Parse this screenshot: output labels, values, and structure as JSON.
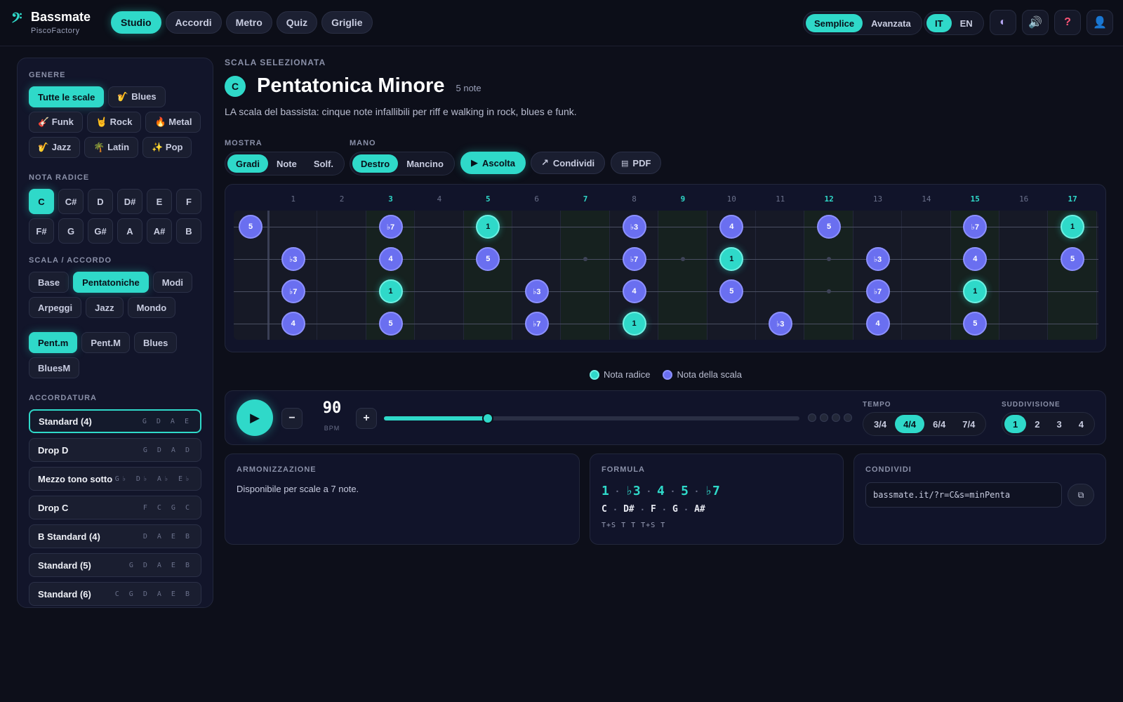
{
  "app": {
    "logo_mark": "𝄢",
    "title": "Bassmate",
    "subtitle": "PiscoFactory"
  },
  "nav": [
    "Studio",
    "Accordi",
    "Metro",
    "Quiz",
    "Griglie"
  ],
  "nav_active": 0,
  "mode": {
    "options": [
      "Semplice",
      "Avanzata"
    ],
    "active": 0
  },
  "lang": {
    "options": [
      "IT",
      "EN"
    ],
    "active": 0
  },
  "header_icons": [
    {
      "name": "theme-icon",
      "glyph": "◐",
      "color": "#b3a5f0"
    },
    {
      "name": "sound-icon",
      "glyph": "🔊",
      "color": "#d6dbff"
    },
    {
      "name": "help-icon",
      "glyph": "?",
      "color": "#ff5577"
    },
    {
      "name": "profile-icon",
      "glyph": "👤",
      "color": "#c8cce0"
    }
  ],
  "sidebar": {
    "genre_label": "GENERE",
    "genres": [
      {
        "label": "Tutte le scale",
        "active": true
      },
      {
        "label": "🎷 Blues"
      },
      {
        "label": "🎸 Funk"
      },
      {
        "label": "🤘 Rock"
      },
      {
        "label": "🔥 Metal"
      },
      {
        "label": "🎷 Jazz"
      },
      {
        "label": "🌴 Latin"
      },
      {
        "label": "✨ Pop"
      }
    ],
    "root_label": "NOTA RADICE",
    "roots": [
      "C",
      "C#",
      "D",
      "D#",
      "E",
      "F",
      "F#",
      "G",
      "G#",
      "A",
      "A#",
      "B"
    ],
    "root_active": 0,
    "scale_label": "SCALA / ACCORDO",
    "scale_types": [
      {
        "label": "Base"
      },
      {
        "label": "Pentatoniche",
        "active": true
      },
      {
        "label": "Modi"
      },
      {
        "label": "Arpeggi"
      },
      {
        "label": "Jazz"
      },
      {
        "label": "Mondo"
      }
    ],
    "scales": [
      {
        "label": "Pent.m",
        "active": true
      },
      {
        "label": "Pent.M"
      },
      {
        "label": "Blues"
      },
      {
        "label": "BluesM"
      }
    ],
    "tuning_label": "ACCORDATURA",
    "tunings": [
      {
        "name": "Standard (4)",
        "notes": "G D A E",
        "active": true
      },
      {
        "name": "Drop D",
        "notes": "G D A D"
      },
      {
        "name": "Mezzo tono sotto",
        "notes": "G♭ D♭ A♭ E♭"
      },
      {
        "name": "Drop C",
        "notes": "F C G C"
      },
      {
        "name": "B Standard (4)",
        "notes": "D A E B"
      },
      {
        "name": "Standard (5)",
        "notes": "G D A E B"
      },
      {
        "name": "Standard (6)",
        "notes": "C G D A E B"
      }
    ]
  },
  "main": {
    "selected_label": "SCALA SELEZIONATA",
    "root": "C",
    "scale_name": "Pentatonica Minore",
    "note_count": "5 note",
    "description": "LA scala del bassista: cinque note infallibili per riff e walking in rock, blues e funk.",
    "show_label": "MOSTRA",
    "show_options": [
      "Gradi",
      "Note",
      "Solf."
    ],
    "show_active": 0,
    "hand_label": "MANO",
    "hand_options": [
      "Destro",
      "Mancino"
    ],
    "hand_active": 0,
    "listen_label": "Ascolta",
    "share_label": "Condividi",
    "pdf_label": "PDF"
  },
  "fretboard": {
    "frets": 17,
    "marked_frets": [
      3,
      5,
      7,
      9,
      12,
      15,
      17
    ],
    "strings": [
      [
        [
          0,
          "5",
          0
        ],
        [
          3,
          "♭7",
          0
        ],
        [
          5,
          "1",
          1
        ],
        [
          8,
          "♭3",
          0
        ],
        [
          10,
          "4",
          0
        ],
        [
          12,
          "5",
          0
        ],
        [
          15,
          "♭7",
          0
        ],
        [
          17,
          "1",
          1
        ]
      ],
      [
        [
          1,
          "♭3",
          0
        ],
        [
          3,
          "4",
          0
        ],
        [
          5,
          "5",
          0
        ],
        [
          8,
          "♭7",
          0
        ],
        [
          10,
          "1",
          1
        ],
        [
          13,
          "♭3",
          0
        ],
        [
          15,
          "4",
          0
        ],
        [
          17,
          "5",
          0
        ]
      ],
      [
        [
          1,
          "♭7",
          0
        ],
        [
          3,
          "1",
          1
        ],
        [
          6,
          "♭3",
          0
        ],
        [
          8,
          "4",
          0
        ],
        [
          10,
          "5",
          0
        ],
        [
          13,
          "♭7",
          0
        ],
        [
          15,
          "1",
          1
        ]
      ],
      [
        [
          1,
          "4",
          0
        ],
        [
          3,
          "5",
          0
        ],
        [
          6,
          "♭7",
          0
        ],
        [
          8,
          "1",
          1
        ],
        [
          11,
          "♭3",
          0
        ],
        [
          13,
          "4",
          0
        ],
        [
          15,
          "5",
          0
        ]
      ]
    ],
    "inlays": [
      [
        7,
        1
      ],
      [
        9,
        1
      ],
      [
        12,
        1
      ],
      [
        12,
        2
      ]
    ]
  },
  "legend": {
    "root": "Nota radice",
    "scale": "Nota della scala"
  },
  "metronome": {
    "bpm": "90",
    "bpm_label": "BPM",
    "min": 40,
    "max": 240,
    "value": 90,
    "minus": "−",
    "plus": "+",
    "beats": 4,
    "tempo_label": "TEMPO",
    "tempo_options": [
      "3/4",
      "4/4",
      "6/4",
      "7/4"
    ],
    "tempo_active": 1,
    "subdiv_label": "SUDDIVISIONE",
    "subdiv_options": [
      "1",
      "2",
      "3",
      "4"
    ],
    "subdiv_active": 0
  },
  "harmonization": {
    "title": "ARMONIZZAZIONE",
    "text": "Disponibile per scale a 7 note."
  },
  "formula": {
    "title": "FORMULA",
    "degrees": [
      "1",
      "♭3",
      "4",
      "5",
      "♭7"
    ],
    "notes": [
      "C",
      "D#",
      "F",
      "G",
      "A#"
    ],
    "steps": "T+S T T T+S T"
  },
  "share": {
    "title": "CONDIVIDI",
    "url": "bassmate.it/?r=C&s=minPenta"
  },
  "colors": {
    "accent": "#2fd9c9",
    "scale_note": "#6a6ff0",
    "background": "#0d0f1a"
  }
}
